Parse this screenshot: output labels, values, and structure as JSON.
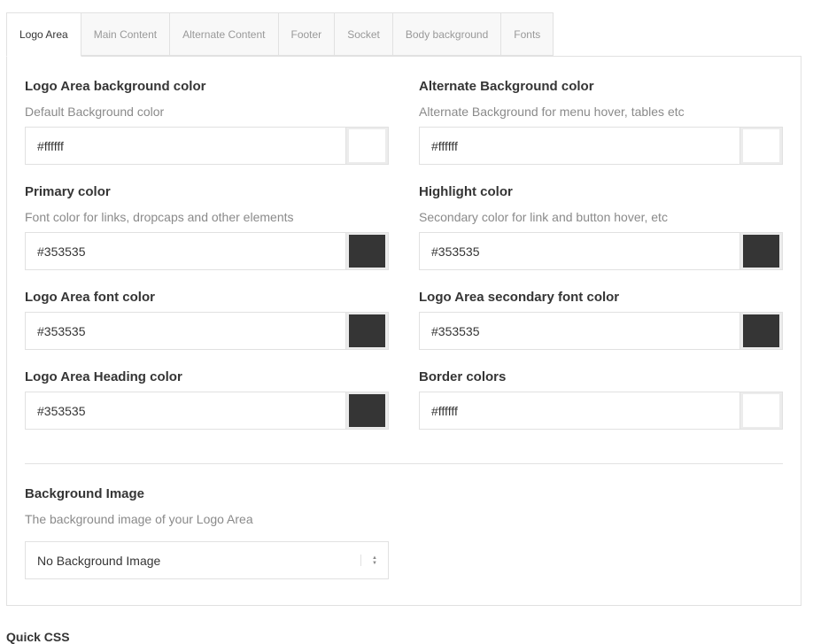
{
  "tabs": [
    {
      "label": "Logo Area",
      "active": true
    },
    {
      "label": "Main Content",
      "active": false
    },
    {
      "label": "Alternate Content",
      "active": false
    },
    {
      "label": "Footer",
      "active": false
    },
    {
      "label": "Socket",
      "active": false
    },
    {
      "label": "Body background",
      "active": false
    },
    {
      "label": "Fonts",
      "active": false
    }
  ],
  "fields": {
    "logo_bg": {
      "title": "Logo Area background color",
      "desc": "Default Background color",
      "value": "#ffffff",
      "swatch": "#ffffff"
    },
    "alt_bg": {
      "title": "Alternate Background color",
      "desc": "Alternate Background for menu hover, tables etc",
      "value": "#ffffff",
      "swatch": "#ffffff"
    },
    "primary": {
      "title": "Primary color",
      "desc": "Font color for links, dropcaps and other elements",
      "value": "#353535",
      "swatch": "#353535"
    },
    "highlight": {
      "title": "Highlight color",
      "desc": "Secondary color for link and button hover, etc",
      "value": "#353535",
      "swatch": "#353535"
    },
    "font": {
      "title": "Logo Area font color",
      "value": "#353535",
      "swatch": "#353535"
    },
    "secondary_font": {
      "title": "Logo Area secondary font color",
      "value": "#353535",
      "swatch": "#353535"
    },
    "heading": {
      "title": "Logo Area Heading color",
      "value": "#353535",
      "swatch": "#353535"
    },
    "border": {
      "title": "Border colors",
      "value": "#ffffff",
      "swatch": "#ffffff"
    }
  },
  "background_image": {
    "title": "Background Image",
    "desc": "The background image of your Logo Area",
    "selected": "No Background Image"
  },
  "bottom_heading": "Quick CSS"
}
